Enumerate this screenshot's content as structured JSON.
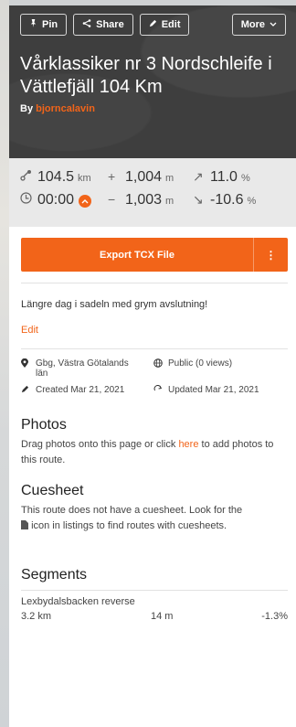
{
  "header": {
    "buttons": {
      "pin": "Pin",
      "share": "Share",
      "edit": "Edit",
      "more": "More"
    },
    "title": "Vårklassiker nr 3 Nordschleife i Vättlefjäll 104 Km",
    "by_label": "By",
    "author": "bjorncalavin"
  },
  "stats": {
    "distance": {
      "value": "104.5",
      "unit": "km"
    },
    "elevation_gain": {
      "value": "1,004",
      "unit": "m"
    },
    "max_grade": {
      "value": "11.0",
      "unit": "%"
    },
    "duration": {
      "value": "00:00"
    },
    "elevation_loss": {
      "value": "1,003",
      "unit": "m"
    },
    "min_grade": {
      "value": "-10.6",
      "unit": "%"
    }
  },
  "export": {
    "label": "Export TCX File",
    "menu_icon": "⋮"
  },
  "description": "Längre dag i sadeln med grym avslutning!",
  "edit_link": "Edit",
  "meta": {
    "location_line1": "Gbg, Västra Götalands",
    "location_line2": "län",
    "visibility": "Public (0 views)",
    "created": "Created Mar 21, 2021",
    "updated": "Updated Mar 21, 2021"
  },
  "photos": {
    "heading": "Photos",
    "text_before": "Drag photos onto this page or click ",
    "link": "here",
    "text_after": " to add photos to this route."
  },
  "cuesheet": {
    "heading": "Cuesheet",
    "text1": "This route does not have a cuesheet. Look for the",
    "text2": "icon in listings to find routes with cuesheets."
  },
  "segments": {
    "heading": "Segments",
    "rows": [
      {
        "name": "Lexbydalsbacken reverse",
        "distance": "3.2 km",
        "elevation": "14 m",
        "grade": "-1.3%"
      }
    ]
  },
  "colors": {
    "accent": "#f26419",
    "hero_bg": "#3e3e3e",
    "stats_bg": "#e9e9e9"
  }
}
